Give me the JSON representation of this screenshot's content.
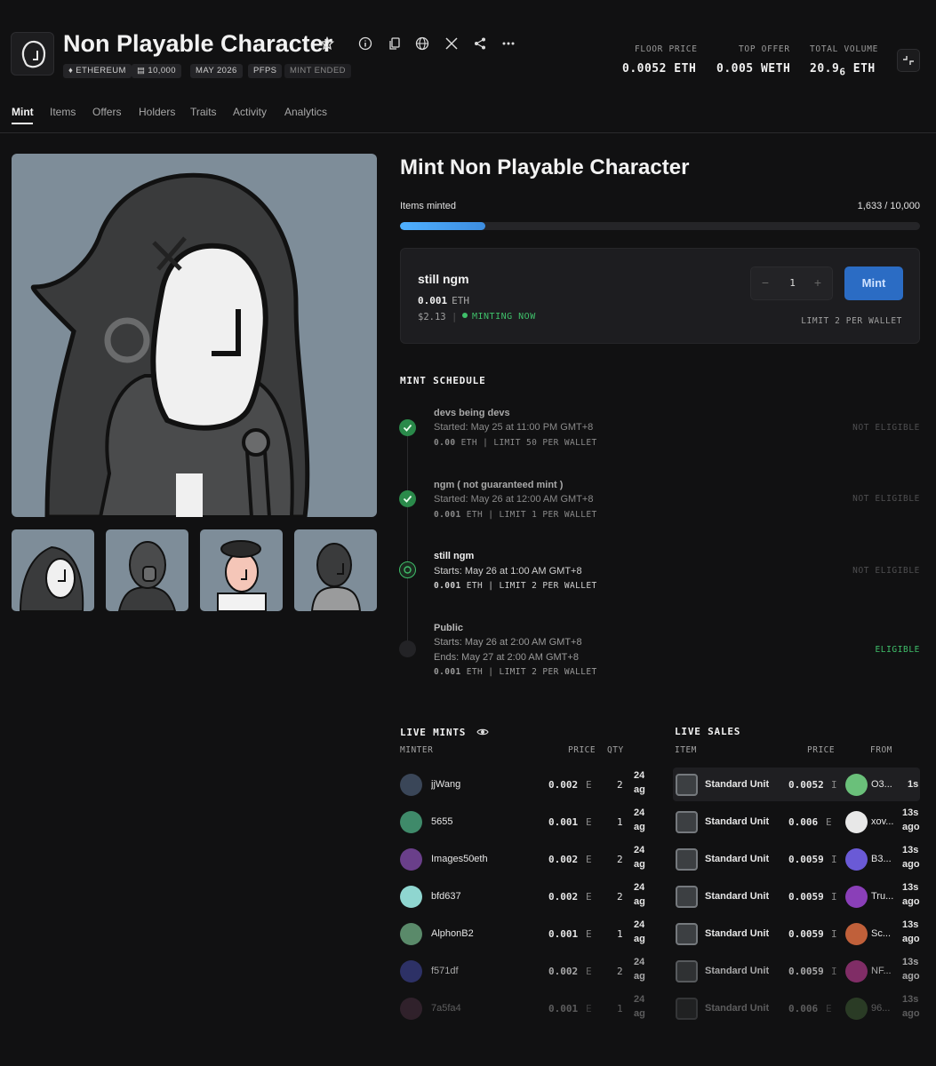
{
  "collection": {
    "title": "Non Playable Character",
    "chips": [
      "ETHEREUM",
      "10,000",
      "MAY 2026",
      "PFPS",
      "MINT ENDED"
    ],
    "stats": [
      {
        "label": "FLOOR PRICE",
        "value": "0.0052 ETH"
      },
      {
        "label": "TOP OFFER",
        "value": "0.005 WETH"
      },
      {
        "label": "TOTAL VOLUME",
        "value": "20.9",
        "sub": "6",
        "unit": "ETH"
      }
    ]
  },
  "nav": {
    "tabs": [
      "Mint",
      "Items",
      "Offers",
      "Holders",
      "Traits",
      "Activity",
      "Analytics"
    ]
  },
  "mint": {
    "title": "Mint Non Playable Character",
    "items_label": "Items minted",
    "items_value": "1,633 / 10,000",
    "progress_fraction": 0.1633,
    "stage": {
      "name": "still ngm",
      "price": "0.001",
      "currency": "ETH",
      "usd": "$2.13",
      "status": "MINTING NOW",
      "quantity": "1",
      "minus": "−",
      "plus": "+",
      "button": "Mint",
      "limit": "LIMIT 2 PER WALLET"
    }
  },
  "schedule": {
    "title": "MINT SCHEDULE",
    "phases": [
      {
        "name": "devs being devs",
        "lines": [
          "Started: May 25 at 11:00 PM GMT+8"
        ],
        "price": "0.00",
        "meta": " ETH  |  LIMIT 50 PER WALLET",
        "eligibility": "NOT ELIGIBLE",
        "state": "done"
      },
      {
        "name": "ngm ( not guaranteed mint )",
        "lines": [
          "Started: May 26 at 12:00 AM GMT+8"
        ],
        "price": "0.001",
        "meta": " ETH  |  LIMIT 1 PER WALLET",
        "eligibility": "NOT ELIGIBLE",
        "state": "done"
      },
      {
        "name": "still ngm",
        "lines": [
          "Starts: May 26 at 1:00 AM GMT+8"
        ],
        "price": "0.001",
        "meta": " ETH  |  LIMIT 2 PER WALLET",
        "eligibility": "NOT ELIGIBLE",
        "state": "active"
      },
      {
        "name": "Public",
        "lines": [
          "Starts: May 26 at 2:00 AM GMT+8",
          "Ends: May 27 at 2:00 AM GMT+8"
        ],
        "price": "0.001",
        "meta": " ETH  |  LIMIT 2 PER WALLET",
        "eligibility": "ELIGIBLE",
        "state": "future"
      }
    ]
  },
  "live_mints": {
    "title": "LIVE MINTS",
    "headers": [
      "MINTER",
      "PRICE",
      "QTY"
    ],
    "rows": [
      {
        "minter": "jjWang",
        "price": "0.002",
        "cur": "E",
        "qty": "2",
        "t1": "24",
        "t2": "ag",
        "color": "#3a4658"
      },
      {
        "minter": "5655",
        "price": "0.001",
        "cur": "E",
        "qty": "1",
        "t1": "24",
        "t2": "ag",
        "color": "#3f8a6a"
      },
      {
        "minter": "Images50eth",
        "price": "0.002",
        "cur": "E",
        "qty": "2",
        "t1": "24",
        "t2": "ag",
        "color": "#6a3f8a"
      },
      {
        "minter": "bfd637",
        "price": "0.002",
        "cur": "E",
        "qty": "2",
        "t1": "24",
        "t2": "ag",
        "color": "#8fd6d0"
      },
      {
        "minter": "AlphonB2",
        "price": "0.001",
        "cur": "E",
        "qty": "1",
        "t1": "24",
        "t2": "ag",
        "color": "#5a8a6a"
      },
      {
        "minter": "f571df",
        "price": "0.002",
        "cur": "E",
        "qty": "2",
        "t1": "24",
        "t2": "ag",
        "color": "#3a3f8a"
      },
      {
        "minter": "7a5fa4",
        "price": "0.001",
        "cur": "E",
        "qty": "1",
        "t1": "24",
        "t2": "ag",
        "color": "#6a3f5a"
      }
    ]
  },
  "live_sales": {
    "title": "LIVE SALES",
    "headers": [
      "ITEM",
      "PRICE",
      "FROM"
    ],
    "rows": [
      {
        "item": "Standard Unit",
        "price": "0.0052",
        "cur": "I",
        "from": "O3...",
        "t1": "1s",
        "t2": "",
        "color": "#6ac07a"
      },
      {
        "item": "Standard Unit",
        "price": "0.006",
        "cur": "E",
        "from": "xov...",
        "t1": "13s",
        "t2": "ago",
        "color": "#e8e8e8"
      },
      {
        "item": "Standard Unit",
        "price": "0.0059",
        "cur": "I",
        "from": "B3...",
        "t1": "13s",
        "t2": "ago",
        "color": "#6a5ad6"
      },
      {
        "item": "Standard Unit",
        "price": "0.0059",
        "cur": "I",
        "from": "Tru...",
        "t1": "13s",
        "t2": "ago",
        "color": "#8a3fb8"
      },
      {
        "item": "Standard Unit",
        "price": "0.0059",
        "cur": "I",
        "from": "Sc...",
        "t1": "13s",
        "t2": "ago",
        "color": "#c0603a"
      },
      {
        "item": "Standard Unit",
        "price": "0.0059",
        "cur": "I",
        "from": "NF...",
        "t1": "13s",
        "t2": "ago",
        "color": "#b03a8a"
      },
      {
        "item": "Standard Unit",
        "price": "0.006",
        "cur": "E",
        "from": "96...",
        "t1": "13s",
        "t2": "ago",
        "color": "#5a8a4a"
      }
    ]
  }
}
